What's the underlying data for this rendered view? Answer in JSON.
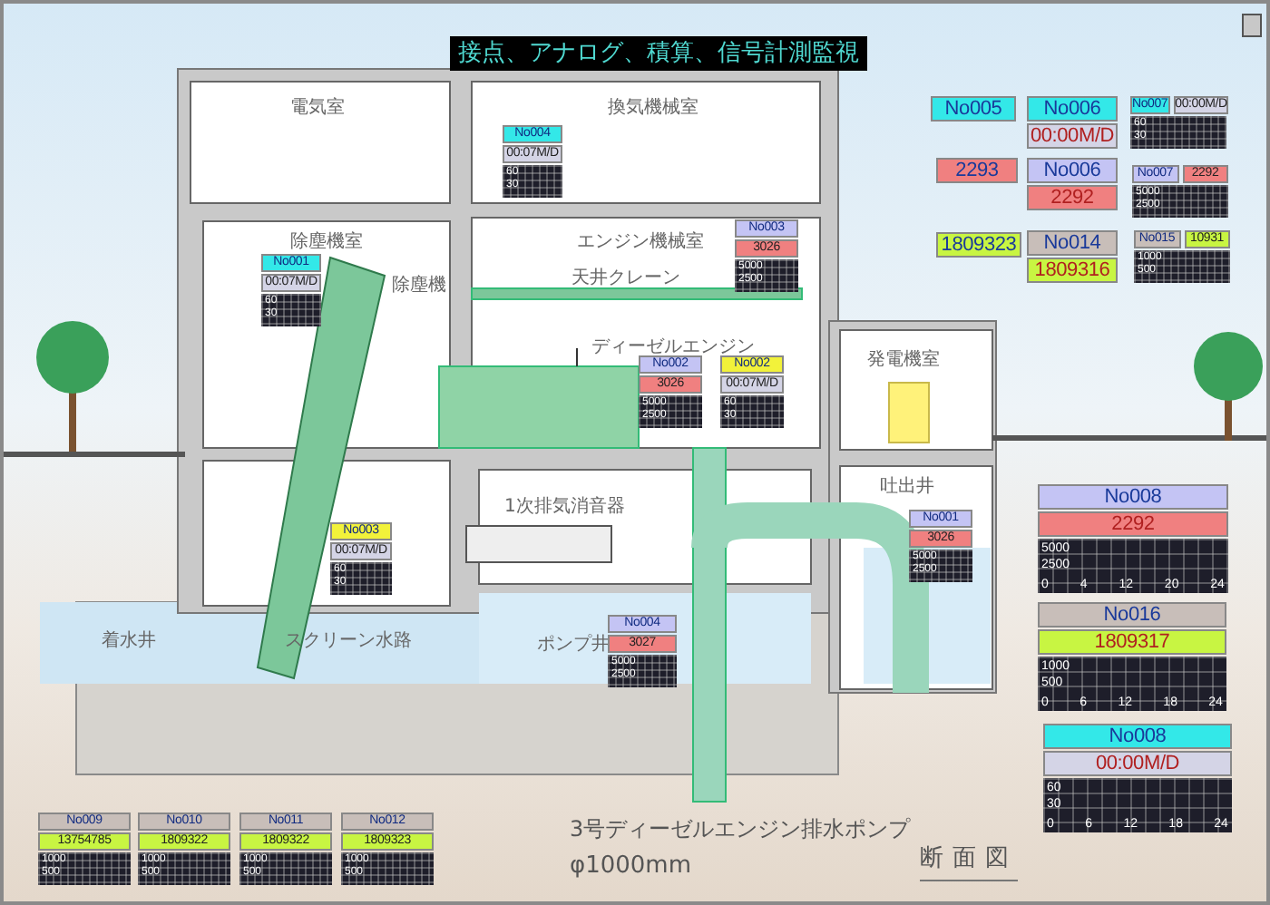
{
  "title": "接点、アナログ、積算、信号計測監視",
  "rooms": [
    {
      "text": "電気室"
    },
    {
      "text": "換気機械室"
    },
    {
      "text": "除塵機室"
    },
    {
      "text": "除塵機"
    },
    {
      "text": "エンジン機械室"
    },
    {
      "text": "天井クレーン"
    },
    {
      "text": "ディーゼルエンジン"
    },
    {
      "text": "発電機室"
    },
    {
      "text": "吐出井"
    },
    {
      "text": "1次排気消音器"
    },
    {
      "text": "着水井"
    },
    {
      "text": "スクリーン水路"
    },
    {
      "text": "ポンプ井"
    }
  ],
  "widgets": [
    {
      "kind": "trend",
      "header": {
        "text": "No004",
        "color": "#33e8e8"
      },
      "value": {
        "text": "00:07M/D",
        "color": "#d4d4e6"
      },
      "scale": [
        "60",
        "30"
      ]
    },
    {
      "kind": "trend",
      "header": {
        "text": "No001",
        "color": "#33e8e8"
      },
      "value": {
        "text": "00:07M/D",
        "color": "#d4d4e6"
      },
      "scale": [
        "60",
        "30"
      ]
    },
    {
      "kind": "trend",
      "header": {
        "text": "No003",
        "color": "#f2f23a"
      },
      "value": {
        "text": "00:07M/D",
        "color": "#d4d4e6"
      },
      "scale": [
        "60",
        "30"
      ]
    },
    {
      "kind": "trend",
      "header": {
        "text": "No003",
        "color": "#c4c4f4"
      },
      "value": {
        "text": "3026",
        "color": "#f08080"
      },
      "scale": [
        "5000",
        "2500"
      ]
    },
    {
      "kind": "trend",
      "header": {
        "text": "No002",
        "color": "#c4c4f4"
      },
      "value": {
        "text": "3026",
        "color": "#f08080"
      },
      "scale": [
        "5000",
        "2500"
      ]
    },
    {
      "kind": "trend",
      "header": {
        "text": "No002",
        "color": "#f2f23a"
      },
      "value": {
        "text": "00:07M/D",
        "color": "#d4d4e6"
      },
      "scale": [
        "60",
        "30"
      ]
    },
    {
      "kind": "trend",
      "header": {
        "text": "No001",
        "color": "#c4c4f4"
      },
      "value": {
        "text": "3026",
        "color": "#f08080"
      },
      "scale": [
        "5000",
        "2500"
      ]
    },
    {
      "kind": "trend",
      "header": {
        "text": "No004",
        "color": "#c4c4f4"
      },
      "value": {
        "text": "3027",
        "color": "#f08080"
      },
      "scale": [
        "5000",
        "2500"
      ]
    },
    {
      "kind": "tag",
      "header": {
        "text": "No005",
        "color": "#33e8e8"
      }
    },
    {
      "kind": "pair",
      "header": {
        "text": "No006",
        "color": "#33e8e8"
      },
      "value": {
        "text": "00:00M/D",
        "color": "#d4d4e6"
      }
    },
    {
      "kind": "inline",
      "header": {
        "text": "No007",
        "color": "#33e8e8"
      },
      "value": {
        "text": "00:00M/D",
        "color": "#d4d4e6"
      },
      "scale": [
        "60",
        "30"
      ]
    },
    {
      "kind": "tag",
      "header": {
        "text": "2293",
        "color": "#f08080"
      }
    },
    {
      "kind": "pair",
      "header": {
        "text": "No006",
        "color": "#c4c4f4"
      },
      "value": {
        "text": "2292",
        "color": "#f08080"
      }
    },
    {
      "kind": "inline",
      "header": {
        "text": "No007",
        "color": "#c4c4f4"
      },
      "value": {
        "text": "2292",
        "color": "#f08080"
      },
      "scale": [
        "5000",
        "2500"
      ]
    },
    {
      "kind": "tag",
      "header": {
        "text": "1809323",
        "color": "#c8f542"
      }
    },
    {
      "kind": "pair",
      "header": {
        "text": "No014",
        "color": "#c8beb9"
      },
      "value": {
        "text": "1809316",
        "color": "#c8f542"
      }
    },
    {
      "kind": "inline",
      "header": {
        "text": "No015",
        "color": "#c8beb9"
      },
      "value": {
        "text": "10931",
        "color": "#c8f542"
      },
      "scale": [
        "1000",
        "500"
      ]
    },
    {
      "kind": "trend",
      "header": {
        "text": "No008",
        "color": "#c4c4f4"
      },
      "value": {
        "text": "2292",
        "color": "#f08080"
      },
      "scale": [
        "5000",
        "2500"
      ],
      "xticks": [
        "0",
        "4",
        "12",
        "20",
        "24"
      ]
    },
    {
      "kind": "trend",
      "header": {
        "text": "No016",
        "color": "#c8beb9"
      },
      "value": {
        "text": "1809317",
        "color": "#c8f542"
      },
      "scale": [
        "1000",
        "500"
      ],
      "xticks": [
        "0",
        "6",
        "12",
        "18",
        "24"
      ]
    },
    {
      "kind": "trend",
      "header": {
        "text": "No008",
        "color": "#33e8e8"
      },
      "value": {
        "text": "00:00M/D",
        "color": "#d4d4e6"
      },
      "scale": [
        "60",
        "30"
      ],
      "xticks": [
        "0",
        "6",
        "12",
        "18",
        "24"
      ]
    },
    {
      "kind": "trend",
      "header": {
        "text": "No009",
        "color": "#c8beb9"
      },
      "value": {
        "text": "13754785",
        "color": "#c8f542"
      },
      "scale": [
        "1000",
        "500"
      ]
    },
    {
      "kind": "trend",
      "header": {
        "text": "No010",
        "color": "#c8beb9"
      },
      "value": {
        "text": "1809322",
        "color": "#c8f542"
      },
      "scale": [
        "1000",
        "500"
      ]
    },
    {
      "kind": "trend",
      "header": {
        "text": "No011",
        "color": "#c8beb9"
      },
      "value": {
        "text": "1809322",
        "color": "#c8f542"
      },
      "scale": [
        "1000",
        "500"
      ]
    },
    {
      "kind": "trend",
      "header": {
        "text": "No012",
        "color": "#c8beb9"
      },
      "value": {
        "text": "1809323",
        "color": "#c8f542"
      },
      "scale": [
        "1000",
        "500"
      ]
    }
  ],
  "caption": {
    "pump": "3号ディーゼルエンジン排水ポンプ",
    "size": "φ1000mm",
    "view": "断面図"
  }
}
